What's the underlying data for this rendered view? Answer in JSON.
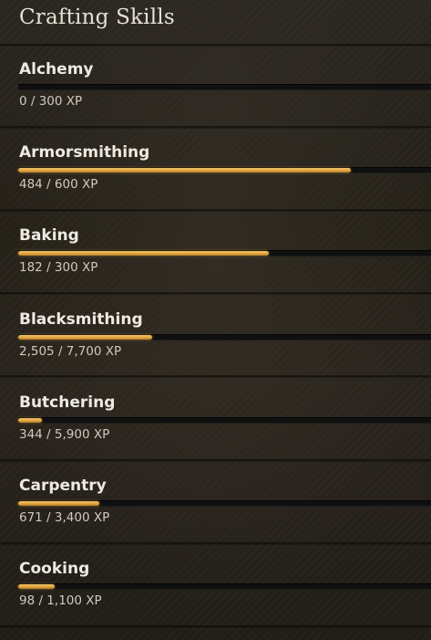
{
  "panel": {
    "title": "Crafting Skills"
  },
  "skills": [
    {
      "name": "Alchemy",
      "xp_text": "0 / 300 XP",
      "progress": 0.0
    },
    {
      "name": "Armorsmithing",
      "xp_text": "484 / 600 XP",
      "progress": 0.8067
    },
    {
      "name": "Baking",
      "xp_text": "182 / 300 XP",
      "progress": 0.6067
    },
    {
      "name": "Blacksmithing",
      "xp_text": "2,505 / 7,700 XP",
      "progress": 0.3253
    },
    {
      "name": "Butchering",
      "xp_text": "344 / 5,900 XP",
      "progress": 0.0583
    },
    {
      "name": "Carpentry",
      "xp_text": "671 / 3,400 XP",
      "progress": 0.1974
    },
    {
      "name": "Cooking",
      "xp_text": "98 / 1,100 XP",
      "progress": 0.0891
    }
  ],
  "colors": {
    "bar_fill": "#e0a63e",
    "bar_track": "#101010",
    "text": "#eeeae2"
  }
}
